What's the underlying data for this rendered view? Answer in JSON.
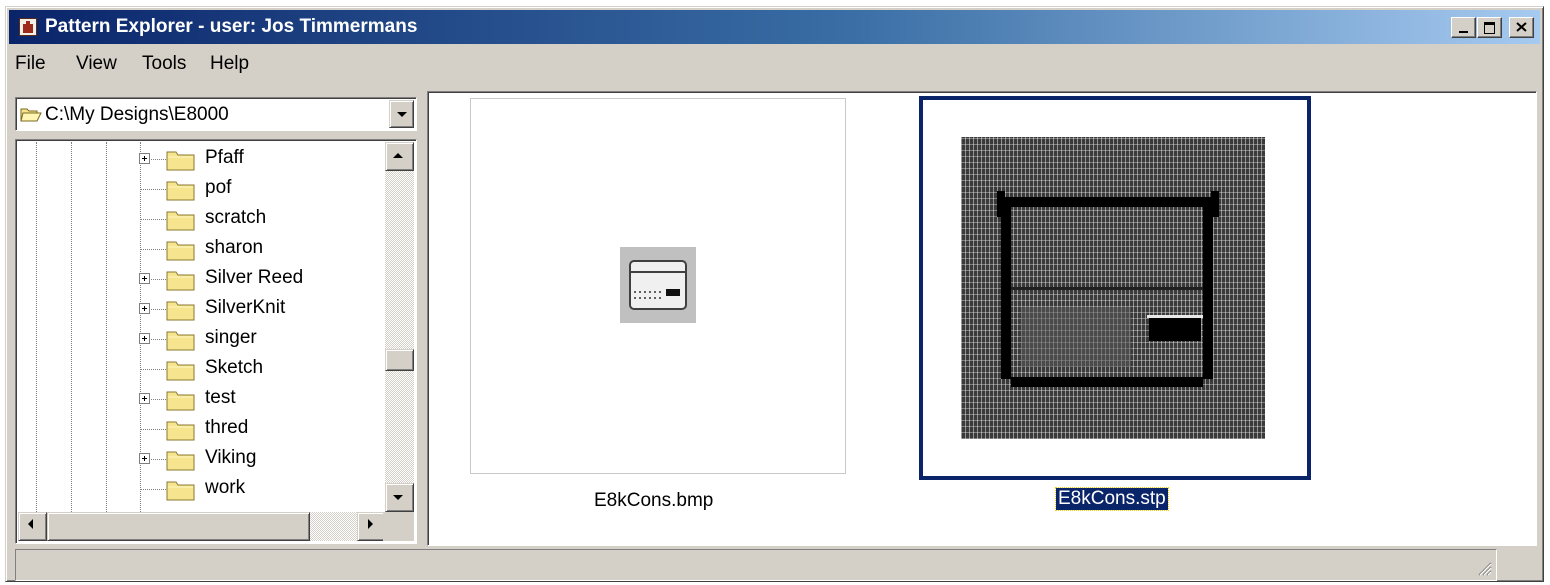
{
  "window": {
    "title": "Pattern Explorer - user: Jos Timmermans"
  },
  "menu": [
    "File",
    "View",
    "Tools",
    "Help"
  ],
  "path_combo": {
    "value": "C:\\My Designs\\E8000"
  },
  "tree": {
    "items": [
      {
        "label": "Pfaff",
        "expandable": true
      },
      {
        "label": "pof",
        "expandable": false
      },
      {
        "label": "scratch",
        "expandable": false
      },
      {
        "label": "sharon",
        "expandable": false
      },
      {
        "label": "Silver Reed",
        "expandable": true
      },
      {
        "label": "SilverKnit",
        "expandable": true
      },
      {
        "label": "singer",
        "expandable": true
      },
      {
        "label": "Sketch",
        "expandable": false
      },
      {
        "label": "test",
        "expandable": true
      },
      {
        "label": "thred",
        "expandable": false
      },
      {
        "label": "Viking",
        "expandable": true
      },
      {
        "label": "work",
        "expandable": false
      }
    ]
  },
  "thumbnails": [
    {
      "filename": "E8kCons.bmp",
      "selected": false
    },
    {
      "filename": "E8kCons.stp",
      "selected": true
    }
  ],
  "colors": {
    "title_gradient_start": "#0a246a",
    "title_gradient_end": "#a6caf0",
    "selection": "#0a246a",
    "folder_yellow": "#f6e48e",
    "chrome": "#d4d0c8"
  },
  "icons": {
    "app": "app-icon",
    "folder": "folder-icon",
    "expand": "plus-box-icon"
  }
}
